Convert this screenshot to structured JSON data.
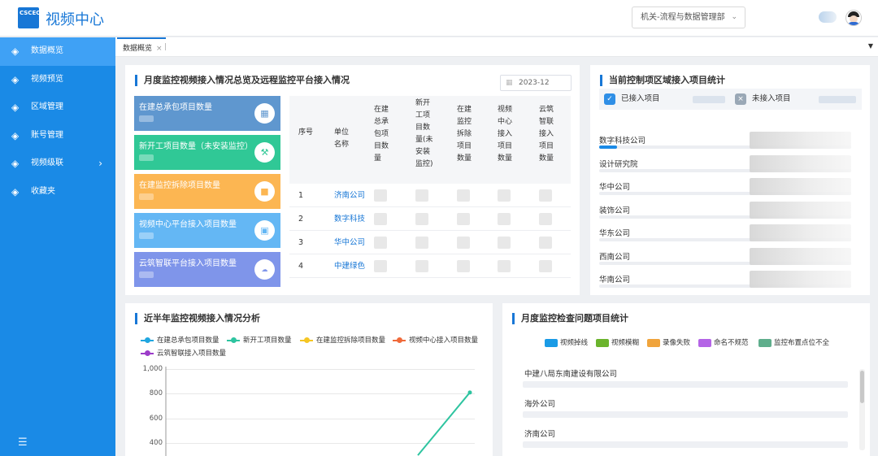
{
  "app": {
    "logo_text": "CSCEC",
    "title": "视频中心"
  },
  "header": {
    "department": "机关-流程与数据管理部",
    "dropdown_icon": "chevron-down-icon",
    "avatar_icon": "user-avatar-icon"
  },
  "sidebar": {
    "items": [
      {
        "label": "数据概览",
        "icon": "layers-icon",
        "active": true
      },
      {
        "label": "视频预览",
        "icon": "layers-icon"
      },
      {
        "label": "区域管理",
        "icon": "layers-icon"
      },
      {
        "label": "账号管理",
        "icon": "layers-icon"
      },
      {
        "label": "视频级联",
        "icon": "layers-icon",
        "has_children": true
      },
      {
        "label": "收藏夹",
        "icon": "layers-icon"
      }
    ],
    "collapse_icon": "menu-collapse-icon"
  },
  "tabs": [
    {
      "label": "数据概览",
      "closable": true,
      "active": true
    }
  ],
  "panel_monthly": {
    "title": "月度监控视频接入情况总览及远程监控平台接入情况",
    "date": "2023-12",
    "cards": [
      {
        "label": "在建总承包项目数量",
        "color": "#5f97cf",
        "icon": "building-icon"
      },
      {
        "label": "新开工项目数量（未安装监控）",
        "color": "#30c896",
        "icon": "crane-icon"
      },
      {
        "label": "在建监控拆除项目数量",
        "color": "#fcb652",
        "icon": "demolish-icon"
      },
      {
        "label": "视频中心平台接入项目数量",
        "color": "#64b7f4",
        "icon": "platform-icon"
      },
      {
        "label": "云筑智联平台接入项目数量",
        "color": "#7f95ea",
        "icon": "cloud-icon"
      }
    ],
    "table": {
      "headers": [
        "序号",
        "单位名称",
        "在建总承包项目数量",
        "新开工项目数量(未安装监控)",
        "在建监控拆除项目数量",
        "视频中心接入项目数量",
        "云筑智联接入项目数量"
      ],
      "rows": [
        {
          "no": "1",
          "unit": "济南公司"
        },
        {
          "no": "2",
          "unit": "数字科技"
        },
        {
          "no": "3",
          "unit": "华中公司"
        },
        {
          "no": "4",
          "unit": "中建绿色"
        }
      ]
    }
  },
  "panel_region": {
    "title": "当前控制项区域接入项目统计",
    "legend": {
      "connected": "已接入项目",
      "not_connected": "未接入项目"
    },
    "companies": [
      "数字科技公司",
      "设计研究院",
      "华中公司",
      "装饰公司",
      "华东公司",
      "西南公司",
      "华南公司"
    ]
  },
  "panel_trend": {
    "title": "近半年监控视频接入情况分析",
    "colors": {
      "s1": "#20a6e0",
      "s2": "#2ec4a0",
      "s3": "#f5c623",
      "s4": "#f06a3a",
      "s5": "#9c3cc9"
    }
  },
  "chart_data": {
    "type": "line",
    "series": [
      {
        "name": "在建总承包项目数量",
        "values": []
      },
      {
        "name": "新开工项目数量",
        "values": [
          null,
          null,
          null,
          null,
          300,
          810
        ]
      },
      {
        "name": "在建监控拆除项目数量",
        "values": []
      },
      {
        "name": "视频中心接入项目数量",
        "values": []
      },
      {
        "name": "云筑智联接入项目数量",
        "values": []
      }
    ],
    "y_ticks": [
      "1,000",
      "800",
      "600",
      "400"
    ],
    "ylim": [
      300,
      1000
    ],
    "grid": true,
    "legend": "top"
  },
  "panel_issues": {
    "title": "月度监控检查问题项目统计",
    "legend": [
      {
        "label": "视频掉线",
        "color": "#1a9be6"
      },
      {
        "label": "视频模糊",
        "color": "#6bb42d"
      },
      {
        "label": "录像失败",
        "color": "#f0a43c"
      },
      {
        "label": "命名不规范",
        "color": "#b464e6"
      },
      {
        "label": "监控布置点位不全",
        "color": "#5fae8c"
      }
    ],
    "companies": [
      "中建八局东南建设有限公司",
      "海外公司",
      "济南公司"
    ]
  }
}
